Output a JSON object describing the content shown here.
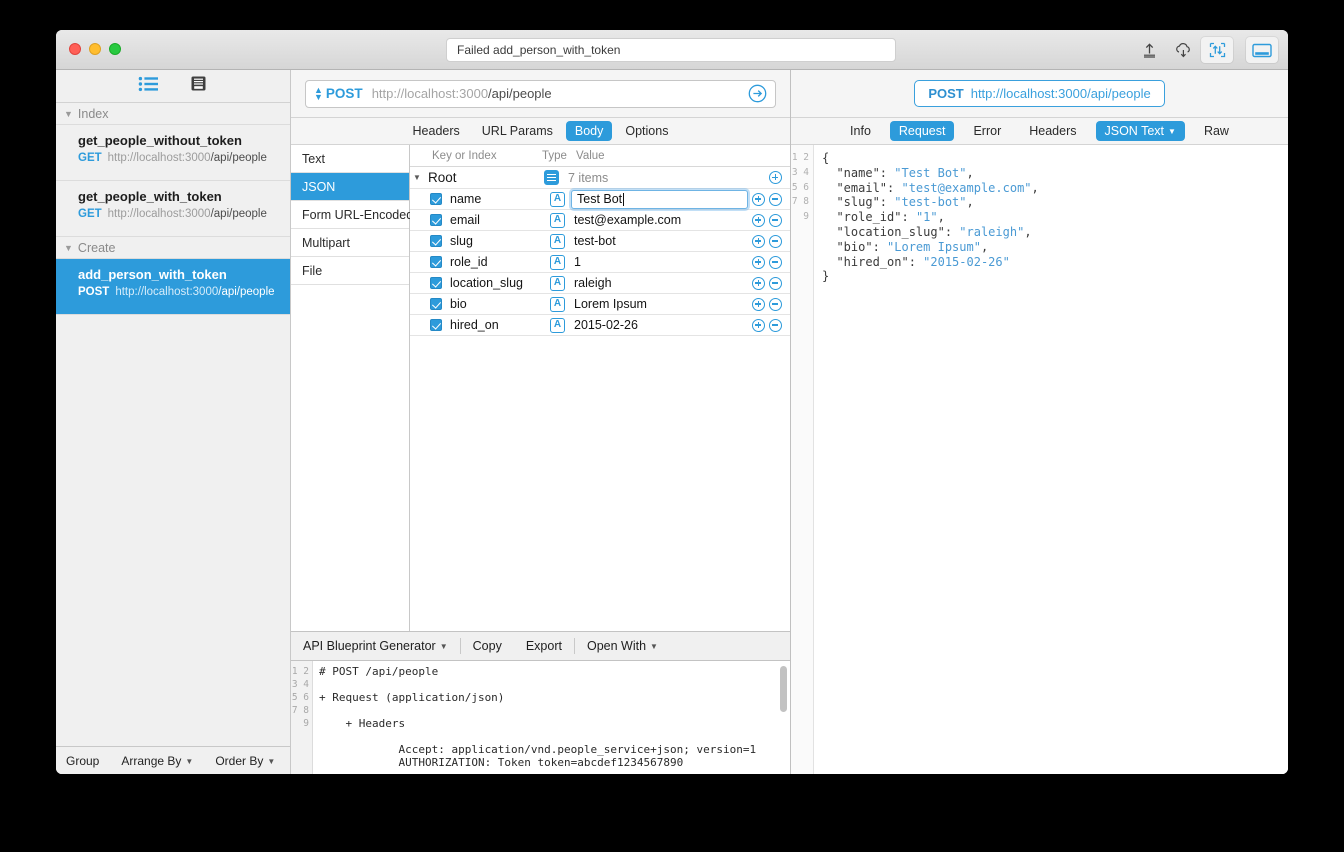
{
  "window": {
    "title_field_value": "Failed add_person_with_token",
    "traffic_lights": [
      "close",
      "minimize",
      "zoom"
    ],
    "toolbar_icons": [
      "share-icon",
      "cloud-sync-icon",
      "import-icon",
      "toggle-panel-icon"
    ]
  },
  "sidebar": {
    "toolbar_icons": [
      "list-view-icon",
      "archive-icon"
    ],
    "groups": [
      {
        "label": "Index",
        "items": [
          {
            "name": "get_people_without_token",
            "method": "GET",
            "host": "http://localhost:3000",
            "path": "/api/people",
            "selected": false
          },
          {
            "name": "get_people_with_token",
            "method": "GET",
            "host": "http://localhost:3000",
            "path": "/api/people",
            "selected": false
          }
        ]
      },
      {
        "label": "Create",
        "items": [
          {
            "name": "add_person_with_token",
            "method": "POST",
            "host": "http://localhost:3000",
            "path": "/api/people",
            "selected": true
          }
        ]
      }
    ],
    "footer": {
      "group": "Group",
      "arrange_by": "Arrange By",
      "order_by": "Order By"
    }
  },
  "request": {
    "method": "POST",
    "url_host": "http://localhost:3000",
    "url_path": "/api/people",
    "send_icon": "send-arrow-icon",
    "tabs": [
      {
        "label": "Headers",
        "active": false
      },
      {
        "label": "URL Params",
        "active": false
      },
      {
        "label": "Body",
        "active": true
      },
      {
        "label": "Options",
        "active": false
      }
    ],
    "body_types": [
      {
        "label": "Text",
        "active": false
      },
      {
        "label": "JSON",
        "active": true
      },
      {
        "label": "Form URL-Encoded",
        "active": false
      },
      {
        "label": "Multipart",
        "active": false
      },
      {
        "label": "File",
        "active": false
      }
    ],
    "kv_headers": {
      "key": "Key or Index",
      "type": "Type",
      "value": "Value"
    },
    "root_row": {
      "label": "Root",
      "type_icon": "object-type-icon",
      "value": "7 items"
    },
    "rows": [
      {
        "key": "name",
        "type": "A",
        "value": "Test Bot",
        "checked": true,
        "editing": true
      },
      {
        "key": "email",
        "type": "A",
        "value": "test@example.com",
        "checked": true,
        "editing": false
      },
      {
        "key": "slug",
        "type": "A",
        "value": "test-bot",
        "checked": true,
        "editing": false
      },
      {
        "key": "role_id",
        "type": "A",
        "value": "1",
        "checked": true,
        "editing": false
      },
      {
        "key": "location_slug",
        "type": "A",
        "value": "raleigh",
        "checked": true,
        "editing": false
      },
      {
        "key": "bio",
        "type": "A",
        "value": "Lorem Ipsum",
        "checked": true,
        "editing": false
      },
      {
        "key": "hired_on",
        "type": "A",
        "value": "2015-02-26",
        "checked": true,
        "editing": false
      }
    ]
  },
  "generator": {
    "name": "API Blueprint Generator",
    "copy": "Copy",
    "export": "Export",
    "open_with": "Open With",
    "code_lines": [
      "# POST /api/people",
      "",
      "+ Request (application/json)",
      "",
      "    + Headers",
      "",
      "            Accept: application/vnd.people_service+json; version=1",
      "            AUTHORIZATION: Token token=abcdef1234567890",
      ""
    ],
    "line_numbers": [
      "1",
      "2",
      "3",
      "4",
      "5",
      "6",
      "7",
      "8",
      "9"
    ]
  },
  "response": {
    "url_method": "POST",
    "url_text": "http://localhost:3000/api/people",
    "tabs": [
      {
        "label": "Info",
        "active": false,
        "has_chevron": false
      },
      {
        "label": "Request",
        "active": true,
        "has_chevron": false
      },
      {
        "label": "Error",
        "active": false,
        "has_chevron": false
      },
      {
        "label": "Headers",
        "active": false,
        "has_chevron": false
      },
      {
        "label": "JSON Text",
        "active": true,
        "has_chevron": true
      },
      {
        "label": "Raw",
        "active": false,
        "has_chevron": false
      }
    ],
    "line_numbers": [
      "1",
      "2",
      "3",
      "4",
      "5",
      "6",
      "7",
      "8",
      "9"
    ],
    "json_lines": [
      {
        "pre": "{",
        "key": "",
        "val": "",
        "post": ""
      },
      {
        "pre": "  ",
        "key": "\"name\"",
        "sep": ": ",
        "val": "\"Test Bot\"",
        "post": ","
      },
      {
        "pre": "  ",
        "key": "\"email\"",
        "sep": ": ",
        "val": "\"test@example.com\"",
        "post": ","
      },
      {
        "pre": "  ",
        "key": "\"slug\"",
        "sep": ": ",
        "val": "\"test-bot\"",
        "post": ","
      },
      {
        "pre": "  ",
        "key": "\"role_id\"",
        "sep": ": ",
        "val": "\"1\"",
        "post": ","
      },
      {
        "pre": "  ",
        "key": "\"location_slug\"",
        "sep": ": ",
        "val": "\"raleigh\"",
        "post": ","
      },
      {
        "pre": "  ",
        "key": "\"bio\"",
        "sep": ": ",
        "val": "\"Lorem Ipsum\"",
        "post": ","
      },
      {
        "pre": "  ",
        "key": "\"hired_on\"",
        "sep": ": ",
        "val": "\"2015-02-26\"",
        "post": ""
      },
      {
        "pre": "}",
        "key": "",
        "val": "",
        "post": ""
      }
    ]
  },
  "colors": {
    "accent": "#2d9bdb",
    "json_string": "#4a9ad4",
    "sidebar_bg": "#f0f0f0",
    "selected_bg": "#2d9bdb"
  }
}
